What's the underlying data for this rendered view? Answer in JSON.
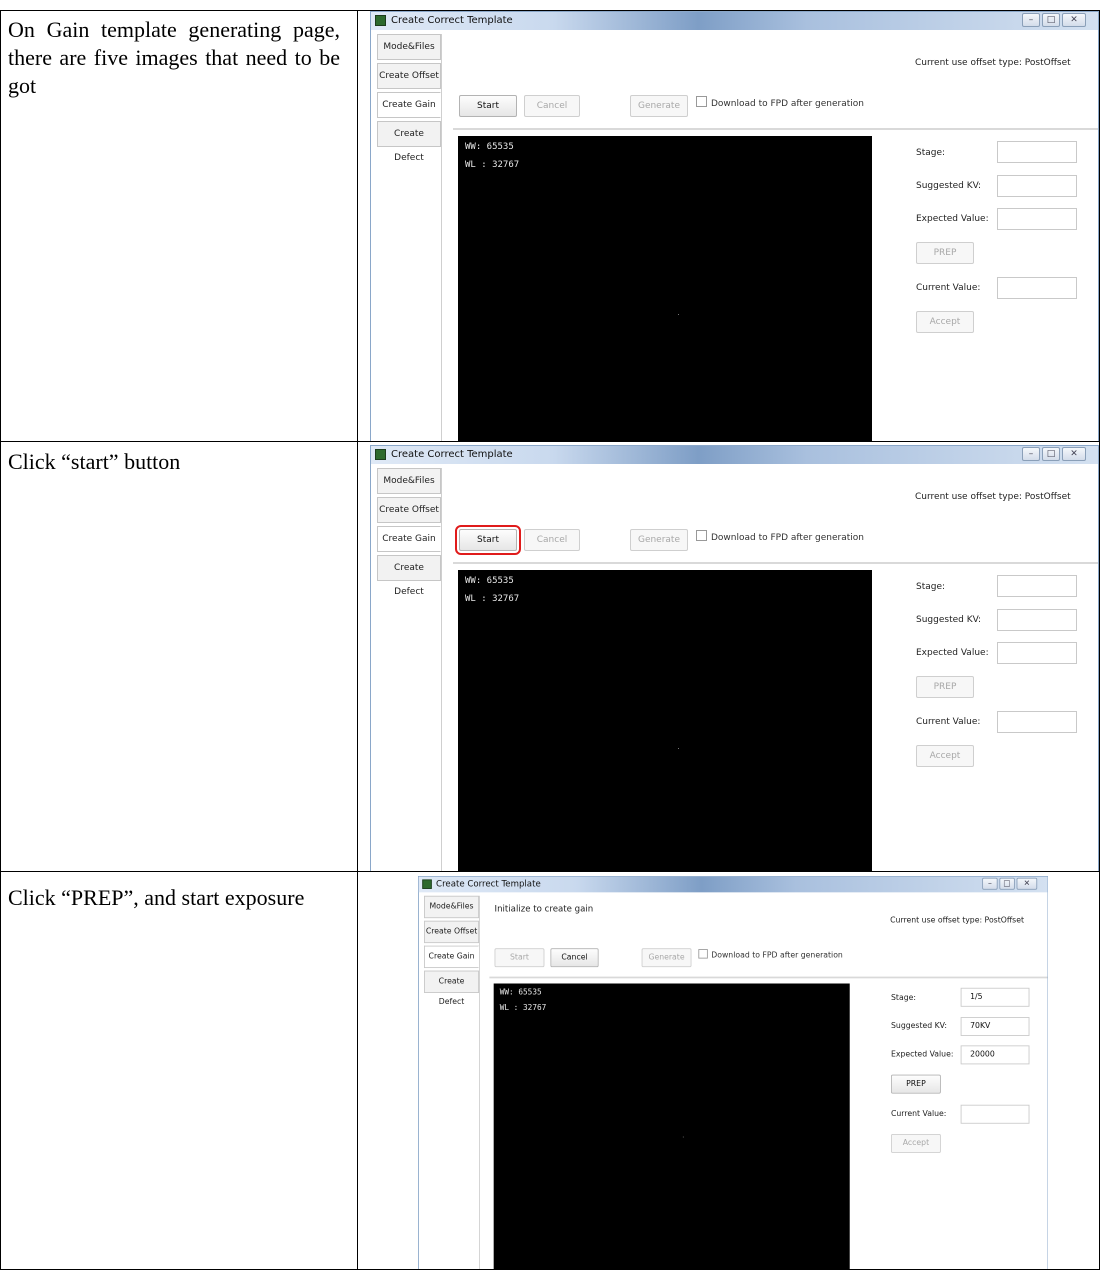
{
  "rows": [
    {
      "instruction": "On Gain template generating page, there are five images that need to be got",
      "screenshot": {
        "window_title": "Create Correct Template",
        "sidebar": [
          "Mode&Files",
          "Create Offset",
          "Create Gain",
          "Create Defect"
        ],
        "active_tab": "Create Gain",
        "status_message": "",
        "offset_type": "Current use offset type: PostOffset",
        "buttons": {
          "start": "Start",
          "cancel": "Cancel",
          "generate": "Generate"
        },
        "start_enabled": true,
        "cancel_enabled": false,
        "start_highlighted": false,
        "download_checkbox": "Download to FPD after generation",
        "ww": "WW:  65535",
        "wl": "WL :  32767",
        "labels": {
          "stage": "Stage:",
          "suggested_kv": "Suggested KV:",
          "expected_value": "Expected Value:",
          "prep": "PREP",
          "current_value": "Current Value:",
          "accept": "Accept"
        },
        "values": {
          "stage": "",
          "suggested_kv": "",
          "expected_value": "",
          "current_value": ""
        },
        "prep_enabled": false
      }
    },
    {
      "instruction": "Click “start” button",
      "screenshot": {
        "window_title": "Create Correct Template",
        "sidebar": [
          "Mode&Files",
          "Create Offset",
          "Create Gain",
          "Create Defect"
        ],
        "active_tab": "Create Gain",
        "status_message": "",
        "offset_type": "Current use offset type: PostOffset",
        "buttons": {
          "start": "Start",
          "cancel": "Cancel",
          "generate": "Generate"
        },
        "start_enabled": true,
        "cancel_enabled": false,
        "start_highlighted": true,
        "download_checkbox": "Download to FPD after generation",
        "ww": "WW:  65535",
        "wl": "WL :  32767",
        "labels": {
          "stage": "Stage:",
          "suggested_kv": "Suggested KV:",
          "expected_value": "Expected Value:",
          "prep": "PREP",
          "current_value": "Current Value:",
          "accept": "Accept"
        },
        "values": {
          "stage": "",
          "suggested_kv": "",
          "expected_value": "",
          "current_value": ""
        },
        "prep_enabled": false
      }
    },
    {
      "instruction": "Click “PREP”, and start exposure",
      "screenshot": {
        "window_title": "Create Correct Template",
        "sidebar": [
          "Mode&Files",
          "Create Offset",
          "Create Gain",
          "Create Defect"
        ],
        "active_tab": "Create Gain",
        "status_message": "Initialize to create gain",
        "offset_type": "Current use offset type: PostOffset",
        "buttons": {
          "start": "Start",
          "cancel": "Cancel",
          "generate": "Generate"
        },
        "start_enabled": false,
        "cancel_enabled": true,
        "start_highlighted": false,
        "download_checkbox": "Download to FPD after generation",
        "ww": "WW:  65535",
        "wl": "WL :  32767",
        "labels": {
          "stage": "Stage:",
          "suggested_kv": "Suggested KV:",
          "expected_value": "Expected Value:",
          "prep": "PREP",
          "current_value": "Current Value:",
          "accept": "Accept"
        },
        "values": {
          "stage": "1/5",
          "suggested_kv": "70KV",
          "expected_value": "20000",
          "current_value": ""
        },
        "prep_enabled": true
      }
    }
  ]
}
